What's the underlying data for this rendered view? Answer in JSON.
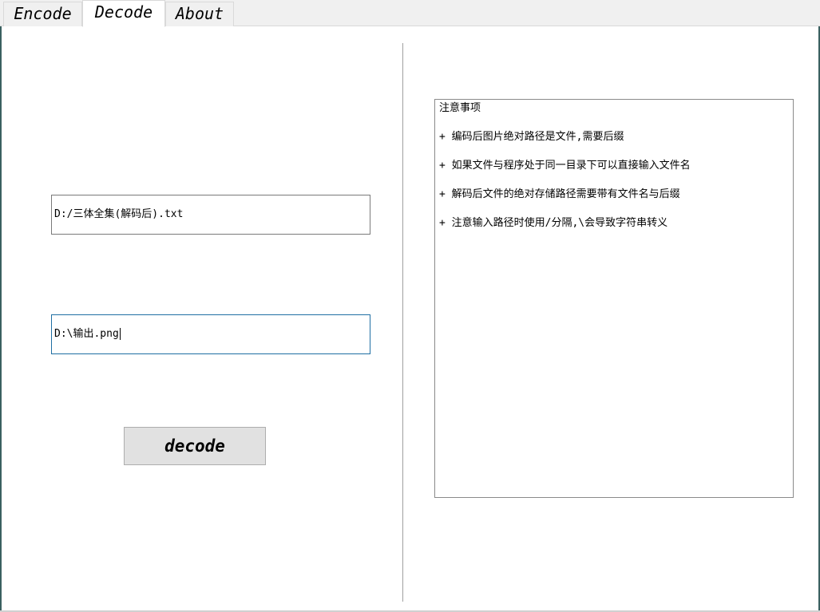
{
  "tabs": [
    {
      "label": "Encode",
      "active": false
    },
    {
      "label": "Decode",
      "active": true
    },
    {
      "label": "About",
      "active": false
    }
  ],
  "decode": {
    "source_path": "D:/三体全集(解码后).txt",
    "output_path": "D:\\输出.png",
    "button_label": "decode"
  },
  "notes": {
    "title": "注意事项",
    "items": [
      "+ 编码后图片绝对路径是文件,需要后缀",
      "+ 如果文件与程序处于同一目录下可以直接输入文件名",
      "+ 解码后文件的绝对存储路径需要带有文件名与后缀",
      "+ 注意输入路径时使用/分隔,\\会导致字符串转义"
    ]
  },
  "colors": {
    "focused_border": "#1f6fa3",
    "button_bg": "#e1e1e1"
  }
}
